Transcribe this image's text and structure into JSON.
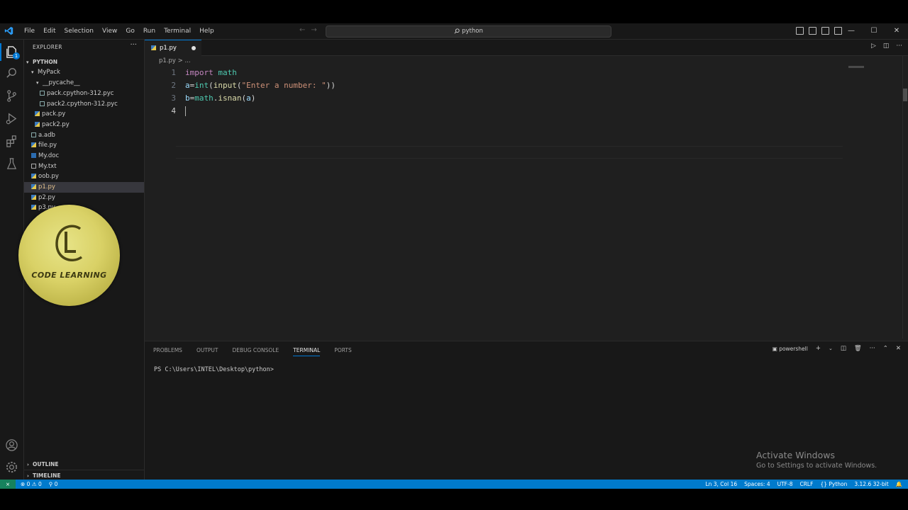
{
  "menu": [
    "File",
    "Edit",
    "Selection",
    "View",
    "Go",
    "Run",
    "Terminal",
    "Help"
  ],
  "search": {
    "label": "python"
  },
  "explorer": {
    "header": "EXPLORER",
    "root": "PYTHON",
    "items": [
      {
        "label": "MyPack",
        "kind": "folder"
      },
      {
        "label": "__pycache__",
        "kind": "folder"
      },
      {
        "label": "pack.cpython-312.pyc",
        "kind": "file"
      },
      {
        "label": "pack2.cpython-312.pyc",
        "kind": "file"
      },
      {
        "label": "pack.py",
        "kind": "py"
      },
      {
        "label": "pack2.py",
        "kind": "py"
      },
      {
        "label": "a.adb",
        "kind": "file"
      },
      {
        "label": "file.py",
        "kind": "py"
      },
      {
        "label": "My.doc",
        "kind": "file"
      },
      {
        "label": "My.txt",
        "kind": "file"
      },
      {
        "label": "oob.py",
        "kind": "py"
      },
      {
        "label": "p1.py",
        "kind": "py"
      },
      {
        "label": "p2.py",
        "kind": "py"
      },
      {
        "label": "p3.py",
        "kind": "py"
      }
    ],
    "outline": "OUTLINE",
    "timeline": "TIMELINE"
  },
  "explorer_badge": "1",
  "logo": {
    "text": "CODE LEARNING"
  },
  "editor": {
    "tab": "p1.py",
    "breadcrumb": "p1.py > ...",
    "lines": [
      {
        "n": "1",
        "text": "import math"
      },
      {
        "n": "2",
        "text": "a=int(input(\"Enter a number: \"))"
      },
      {
        "n": "3",
        "text": "b=math.isnan(a)"
      },
      {
        "n": "4",
        "text": ""
      }
    ]
  },
  "panel": {
    "tabs": [
      "PROBLEMS",
      "OUTPUT",
      "DEBUG CONSOLE",
      "TERMINAL",
      "PORTS"
    ],
    "active": "TERMINAL",
    "shell": "powershell",
    "prompt": "PS C:\\Users\\INTEL\\Desktop\\python>"
  },
  "watermark": {
    "title": "Activate Windows",
    "subtitle": "Go to Settings to activate Windows."
  },
  "status": {
    "errors": "0",
    "warnings": "0",
    "ports": "0",
    "position": "Ln 3, Col 16",
    "spaces": "Spaces: 4",
    "encoding": "UTF-8",
    "eol": "CRLF",
    "language": "Python",
    "interpreter": "3.12.6 32-bit"
  },
  "colors": {
    "accent": "#0078d4",
    "statusbar": "#007acc",
    "keyword": "#c586c0",
    "function": "#dcdcaa",
    "string": "#ce9178"
  }
}
